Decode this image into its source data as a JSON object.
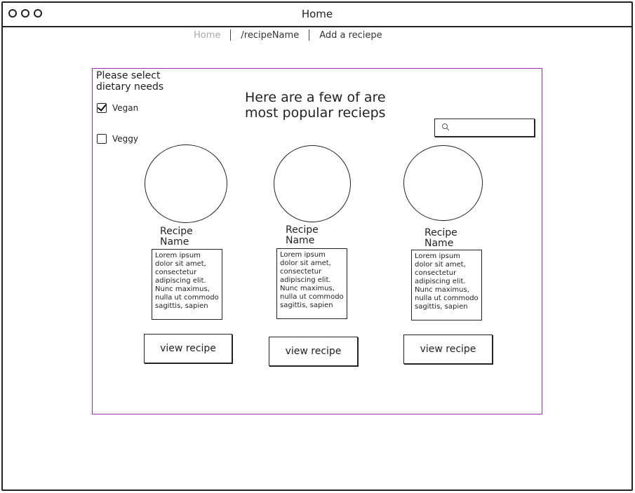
{
  "window": {
    "title": "Home"
  },
  "nav": {
    "items": [
      "Home",
      "/recipeName",
      "Add a reciepe"
    ]
  },
  "diet": {
    "title": "Please select dietary needs",
    "options": [
      {
        "label": "Vegan",
        "checked": true
      },
      {
        "label": "Veggy",
        "checked": false
      }
    ]
  },
  "headline": "Here are a few of are most popular recieps",
  "search": {
    "placeholder": ""
  },
  "recipes": [
    {
      "name": "Recipe Name",
      "description": "Lorem ipsum dolor sit amet, consectetur adipiscing elit. Nunc maximus, nulla ut commodo sagittis, sapien",
      "button": "view recipe"
    },
    {
      "name": "Recipe Name",
      "description": "Lorem ipsum dolor sit amet, consectetur adipiscing elit. Nunc maximus, nulla ut commodo sagittis, sapien",
      "button": "view recipe"
    },
    {
      "name": "Recipe Name",
      "description": "Lorem ipsum dolor sit amet, consectetur adipiscing elit. Nunc maximus, nulla ut commodo sagittis, sapien",
      "button": "view recipe"
    }
  ],
  "icons": {
    "search": "search-icon"
  },
  "colors": {
    "frame": "#9b2fae",
    "nav_active": "#aaaaaa"
  }
}
